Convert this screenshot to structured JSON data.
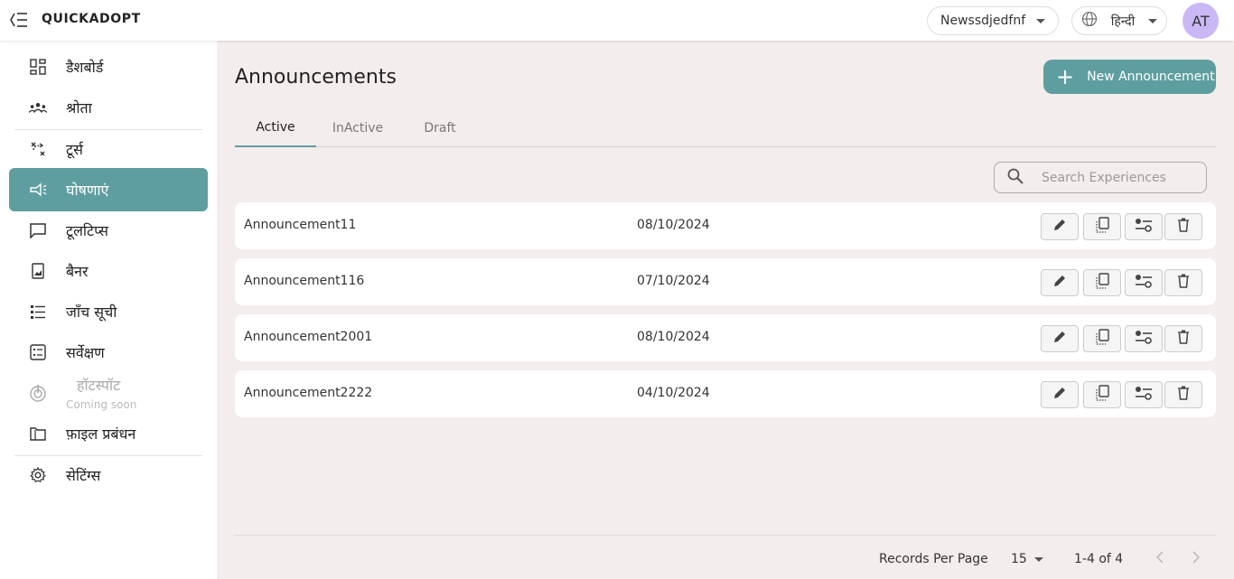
{
  "app": {
    "brand": "QUICKADOPT"
  },
  "header": {
    "account": "Newssdjedfnf",
    "language": "हिन्दी",
    "avatar_initials": "AT"
  },
  "sidebar": {
    "items": [
      {
        "label": "डैशबोर्ड",
        "icon": "dashboard-icon"
      },
      {
        "label": "श्रोता",
        "icon": "audience-icon"
      },
      {
        "label": "टूर्स",
        "icon": "tours-icon"
      },
      {
        "label": "घोषणाएं",
        "icon": "megaphone-icon",
        "active": true
      },
      {
        "label": "टूलटिप्स",
        "icon": "tooltip-icon"
      },
      {
        "label": "बैनर",
        "icon": "banner-icon"
      },
      {
        "label": "जाँच सूची",
        "icon": "checklist-icon"
      },
      {
        "label": "सर्वेक्षण",
        "icon": "survey-icon"
      },
      {
        "label": "हॉटस्पॉट",
        "icon": "hotspot-icon",
        "disabled": true,
        "note": "Coming soon"
      },
      {
        "label": "फ़ाइल प्रबंधन",
        "icon": "folder-icon"
      },
      {
        "label": "सेटिंग्स",
        "icon": "gear-icon"
      }
    ]
  },
  "main": {
    "title": "Announcements",
    "new_button": "New Announcement",
    "tabs": [
      {
        "label": "Active",
        "active": true
      },
      {
        "label": "InActive"
      },
      {
        "label": "Draft"
      }
    ],
    "search_placeholder": "Search Experiences",
    "rows": [
      {
        "name": "Announcement11",
        "date": "08/10/2024"
      },
      {
        "name": "Announcement116",
        "date": "07/10/2024"
      },
      {
        "name": "Announcement2001",
        "date": "08/10/2024"
      },
      {
        "name": "Announcement2222",
        "date": "04/10/2024"
      }
    ],
    "footer": {
      "records_label": "Records Per Page",
      "per_page": "15",
      "range": "1-4 of 4"
    }
  },
  "colors": {
    "accent": "#5f9ea0",
    "background": "#f4eded",
    "avatar": "#c9b8f5"
  }
}
